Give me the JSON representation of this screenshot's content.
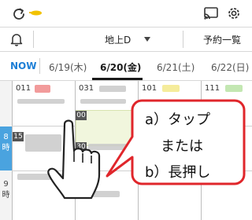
{
  "header": {
    "refresh_icon": "refresh-icon",
    "cast_icon": "cast-icon",
    "settings_icon": "gear-icon"
  },
  "filterbar": {
    "notification_icon": "bell-icon",
    "floor": "地上D",
    "reservations": "予約一覧"
  },
  "dates": {
    "now": "NOW",
    "tabs": [
      "6/19(木)",
      "6/20(金)",
      "6/21(土)",
      "6/22(日)"
    ],
    "active_index": 1
  },
  "grid": {
    "rooms": [
      "011",
      "031",
      "101",
      "111"
    ],
    "times": [
      {
        "hour": "8",
        "unit": "時"
      },
      {
        "hour": "9",
        "unit": "時"
      }
    ],
    "slots": [
      "00",
      "15",
      "30"
    ]
  },
  "callout": {
    "line1": "a）タップ",
    "line2": "または",
    "line3": "b）長押し"
  },
  "colors": {
    "accent": "#1e7fd6",
    "time_highlight": "#4aa3df",
    "callout_border": "#e0262b"
  }
}
